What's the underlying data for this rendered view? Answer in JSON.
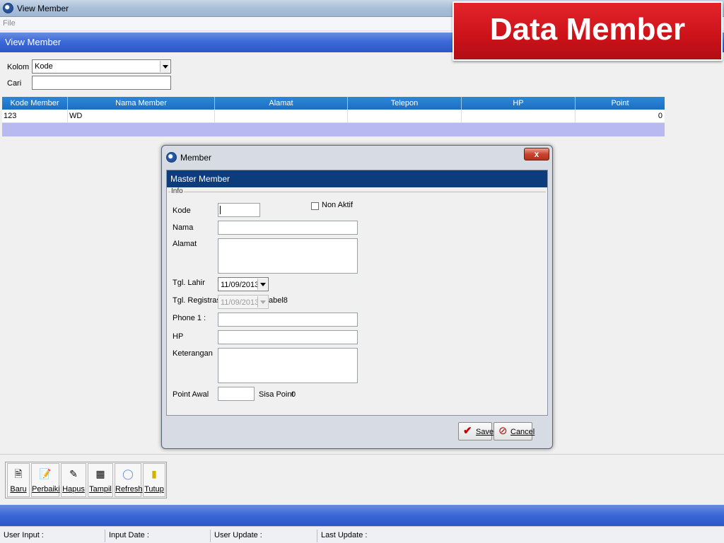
{
  "window": {
    "title": "View Member"
  },
  "menu": {
    "file": "File"
  },
  "view": {
    "title": "View Member",
    "kolom_label": "Kolom",
    "kolom_value": "Kode",
    "cari_label": "Cari",
    "cari_value": ""
  },
  "badge": {
    "text": "Data Member",
    "color": "#d81b22"
  },
  "grid": {
    "columns": [
      "Kode Member",
      "Nama Member",
      "Alamat",
      "Telepon",
      "HP",
      "Point"
    ],
    "rows": [
      {
        "kode": "123",
        "nama": "WD",
        "alamat": "",
        "telepon": "",
        "hp": "",
        "point": "0"
      }
    ]
  },
  "dialog": {
    "title": "Member",
    "close_label": "x",
    "header": "Master Member",
    "group_label": "Info",
    "fields": {
      "kode_label": "Kode",
      "nama_label": "Nama",
      "alamat_label": "Alamat",
      "tgl_lahir_label": "Tgl. Lahir",
      "tgl_lahir_value": "11/09/2013",
      "tgl_registrasi_label": "Tgl. Registrasi :",
      "tgl_registrasi_value": "11/09/2013",
      "label8": "abel8",
      "phone1_label": "Phone 1 :",
      "hp_label": "HP",
      "keterangan_label": "Keterangan",
      "point_awal_label": "Point Awal",
      "sisa_point_label": "Sisa Point",
      "sisa_point_value": "0",
      "non_aktif_label": "Non Aktif"
    },
    "save_label": "Save",
    "cancel_label": "Cancel"
  },
  "toolbar": {
    "baru": "Baru",
    "perbaiki": "Perbaiki",
    "hapus": "Hapus",
    "tampil": "Tampil",
    "refresh": "Refresh",
    "tutup": "Tutup"
  },
  "status": {
    "user_input": "User Input :",
    "input_date": "Input Date :",
    "user_update": "User Update :",
    "last_update": "Last Update :"
  },
  "icons": {
    "app": "app-icon",
    "close": "close-icon",
    "save": "checkmark-icon",
    "cancel": "cancel-icon",
    "baru": "new-document-icon",
    "perbaiki": "edit-document-icon",
    "hapus": "eraser-icon",
    "tampil": "display-icon",
    "refresh": "lightbulb-icon",
    "tutup": "exit-door-icon"
  }
}
